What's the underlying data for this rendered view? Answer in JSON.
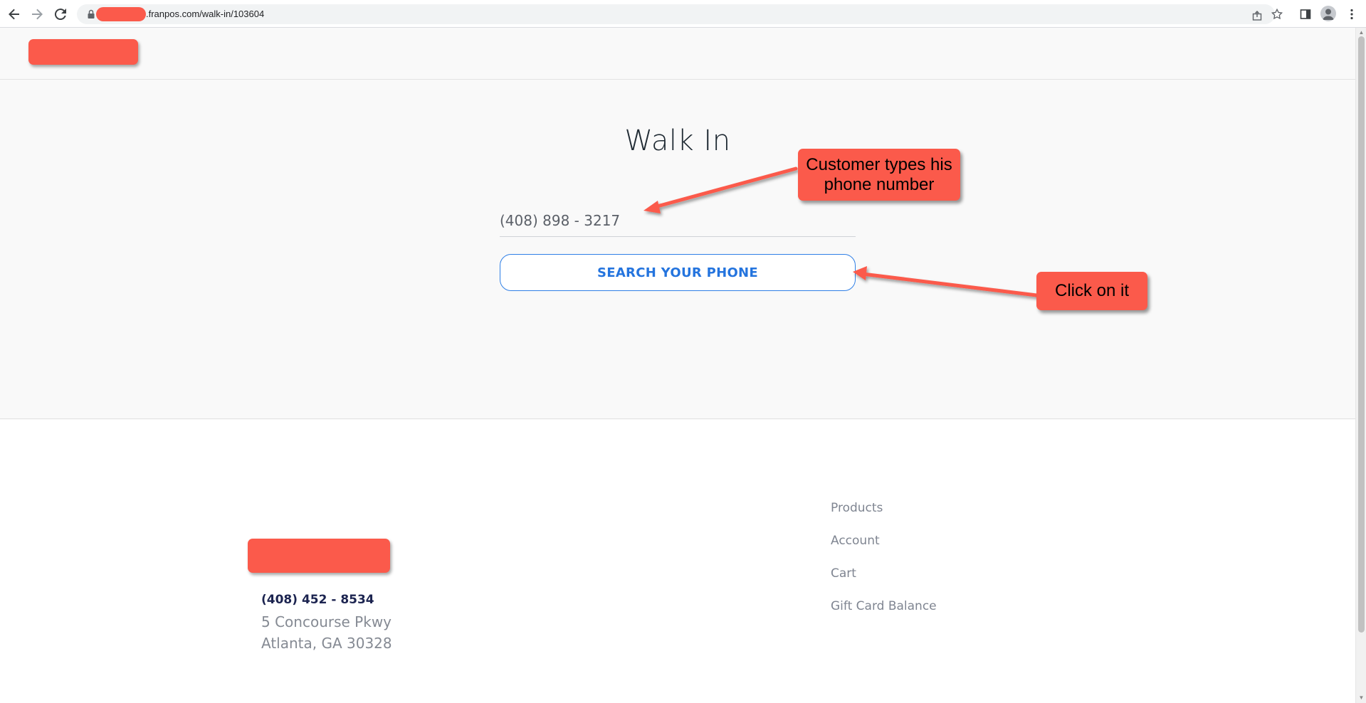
{
  "browser": {
    "url_text": ".franpos.com/walk-in/103604",
    "icons": [
      "back-arrow-icon",
      "forward-arrow-icon",
      "reload-icon",
      "lock-icon",
      "share-icon",
      "star-icon",
      "side-panel-icon",
      "profile-icon",
      "menu-icon"
    ]
  },
  "page": {
    "title": "Walk In",
    "phone_input_value": "(408) 898 - 3217",
    "search_button_label": "SEARCH YOUR PHONE"
  },
  "footer": {
    "phone": "(408) 452 - 8534",
    "address_line1": "5 Concourse Pkwy",
    "address_line2": "Atlanta, GA 30328",
    "links": [
      "Products",
      "Account",
      "Cart",
      "Gift Card Balance"
    ]
  },
  "annotations": {
    "callout_phone": "Customer types his phone number",
    "callout_click": "Click on it"
  },
  "colors": {
    "accent_blue": "#2474de",
    "annotation_red": "#fb5a4b",
    "title_text": "#1f2a33",
    "footer_phone": "#1c2450"
  }
}
